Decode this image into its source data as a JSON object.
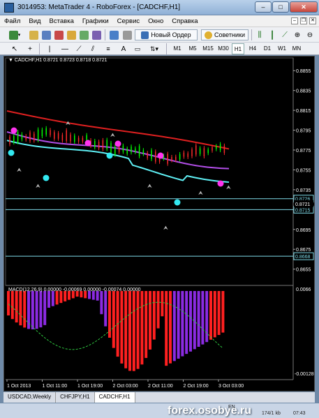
{
  "window": {
    "title": "3014953: MetaTrader 4 - RoboForex - [CADCHF,H1]",
    "btn_min": "–",
    "btn_max": "□",
    "btn_close": "✕"
  },
  "menu": [
    "Файл",
    "Вид",
    "Вставка",
    "Графики",
    "Сервис",
    "Окно",
    "Справка"
  ],
  "toolbar": {
    "new_order": "Новый Ордер",
    "advisors": "Советники"
  },
  "timeframes": [
    "M1",
    "M5",
    "M15",
    "M30",
    "H1",
    "H4",
    "D1",
    "W1",
    "MN"
  ],
  "active_timeframe": "H1",
  "chart": {
    "symbol_info": "CADCHF,H1  0.8721 0.8723 0.8718 0.8721",
    "price_axis": [
      "0.8855",
      "0.8835",
      "0.8815",
      "0.8795",
      "0.8775",
      "0.8755",
      "0.8735",
      "0.8715",
      "0.8695",
      "0.8675",
      "0.8655"
    ],
    "price_min": 0.864,
    "price_max": 0.8865,
    "hlines": [
      {
        "label": "0.8726",
        "price": 0.8726,
        "color": "#7fdcea"
      },
      {
        "label": "0.8715",
        "price": 0.8715,
        "color": "#7fdcea"
      },
      {
        "label": "0.8668",
        "price": 0.8668,
        "color": "#7fdcea"
      }
    ],
    "current_price_label": "0.8721",
    "current_price": 0.8721,
    "time_axis": [
      "1 Oct 2013",
      "1 Oct 11:00",
      "1 Oct 19:00",
      "2 Oct 03:00",
      "2 Oct 11:00",
      "2 Oct 19:00",
      "3 Oct 03:00"
    ],
    "colors": {
      "bull": "#00ff00",
      "bear": "#ff2a2a",
      "red_ma": "#e02020",
      "purple_ma": "#b24ee8",
      "cyan_ma": "#5ff0f5",
      "magenta_dot": "#ff33ee",
      "cyan_dot": "#33e8f0",
      "macd_pos": "#8b2be2",
      "macd_neg": "#ff2020"
    }
  },
  "macd": {
    "label": "MACD(12,26,9) 0.00000 -0.00069 0.00000 -0.00074 0.00000",
    "axis_top": "0.0066",
    "axis_bottom": "-0.00128"
  },
  "tabs": [
    "USDCAD,Weekly",
    "CHFJPY,H1",
    "CADCHF,H1"
  ],
  "active_tab": "CADCHF,H1",
  "status": {
    "watermark": "forex.osobye.ru",
    "lang": "EN",
    "traffic": "174/1 kb",
    "clock": "07:43"
  }
}
